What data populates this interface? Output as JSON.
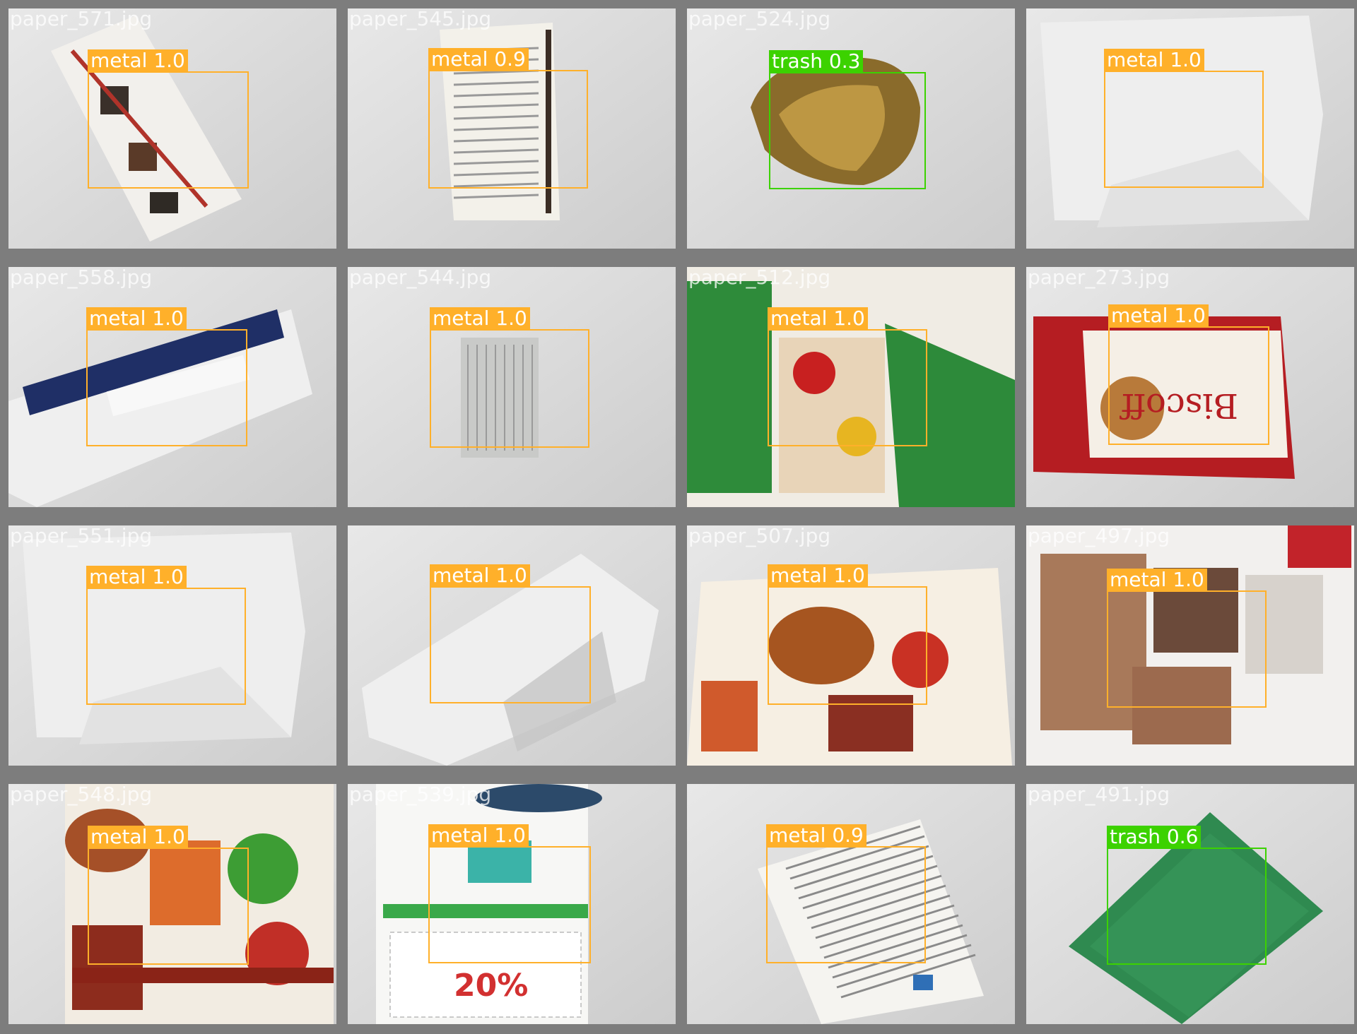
{
  "colors": {
    "grid_background": "#7d7d7d",
    "metal": "#ffb02a",
    "trash": "#3cd200"
  },
  "tiles": [
    {
      "filename": "paper_571.jpg",
      "detection": {
        "label": "metal 1.0",
        "class": "metal"
      },
      "scene": "ad"
    },
    {
      "filename": "paper_545.jpg",
      "detection": {
        "label": "metal 0.9",
        "class": "metal"
      },
      "scene": "doc"
    },
    {
      "filename": "paper_524.jpg",
      "detection": {
        "label": "trash 0.3",
        "class": "trash"
      },
      "scene": "can"
    },
    {
      "filename": "",
      "detection": {
        "label": "metal 1.0",
        "class": "metal"
      },
      "scene": "envelope"
    },
    {
      "filename": "paper_558.jpg",
      "detection": {
        "label": "metal 1.0",
        "class": "metal"
      },
      "scene": "card"
    },
    {
      "filename": "paper_544.jpg",
      "detection": {
        "label": "metal 1.0",
        "class": "metal"
      },
      "scene": "receipt"
    },
    {
      "filename": "paper_512.jpg",
      "detection": {
        "label": "metal 1.0",
        "class": "metal"
      },
      "scene": "flyer"
    },
    {
      "filename": "paper_273.jpg",
      "detection": {
        "label": "metal 1.0",
        "class": "metal"
      },
      "scene": "biscoff"
    },
    {
      "filename": "paper_551.jpg",
      "detection": {
        "label": "metal 1.0",
        "class": "metal"
      },
      "scene": "envelope"
    },
    {
      "filename": "",
      "detection": {
        "label": "metal 1.0",
        "class": "metal"
      },
      "scene": "envelope2"
    },
    {
      "filename": "paper_507.jpg",
      "detection": {
        "label": "metal 1.0",
        "class": "metal"
      },
      "scene": "grocery"
    },
    {
      "filename": "paper_497.jpg",
      "detection": {
        "label": "metal 1.0",
        "class": "metal"
      },
      "scene": "closet"
    },
    {
      "filename": "paper_548.jpg",
      "detection": {
        "label": "metal 1.0",
        "class": "metal"
      },
      "scene": "grocery2"
    },
    {
      "filename": "paper_539.jpg",
      "detection": {
        "label": "metal 1.0",
        "class": "metal"
      },
      "scene": "kids"
    },
    {
      "filename": "",
      "detection": {
        "label": "metal 0.9",
        "class": "metal"
      },
      "scene": "letter"
    },
    {
      "filename": "paper_491.jpg",
      "detection": {
        "label": "trash 0.6",
        "class": "trash"
      },
      "scene": "green"
    }
  ]
}
